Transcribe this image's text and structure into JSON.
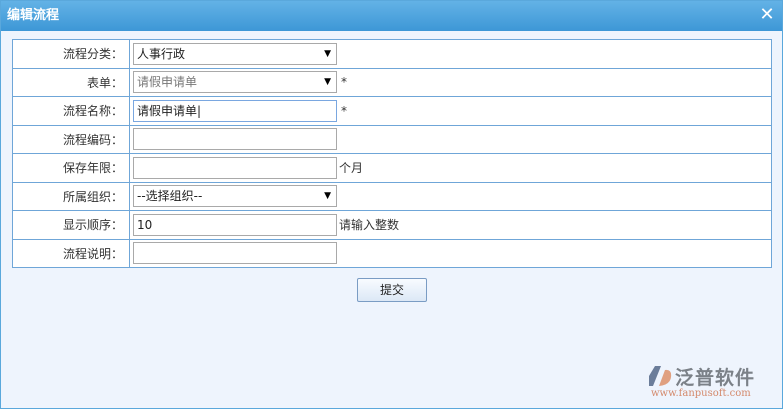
{
  "dialog": {
    "title": "编辑流程"
  },
  "form": {
    "rows": [
      {
        "label": "流程分类：",
        "value": "人事行政",
        "type": "select"
      },
      {
        "label": "表单：",
        "value": "请假申请单",
        "type": "select",
        "required": "*"
      },
      {
        "label": "流程名称：",
        "value": "请假申请单",
        "type": "text",
        "required": "*"
      },
      {
        "label": "流程编码：",
        "value": "",
        "type": "text"
      },
      {
        "label": "保存年限：",
        "value": "",
        "type": "text",
        "suffix": "个月"
      },
      {
        "label": "所属组织：",
        "value": "--选择组织--",
        "type": "select"
      },
      {
        "label": "显示顺序：",
        "value": "10",
        "type": "text",
        "suffix": "请输入整数"
      },
      {
        "label": "流程说明：",
        "value": "",
        "type": "text"
      }
    ]
  },
  "submit_label": "提交",
  "logo": {
    "name": "泛普软件",
    "url": "www.fanpusoft.com"
  }
}
